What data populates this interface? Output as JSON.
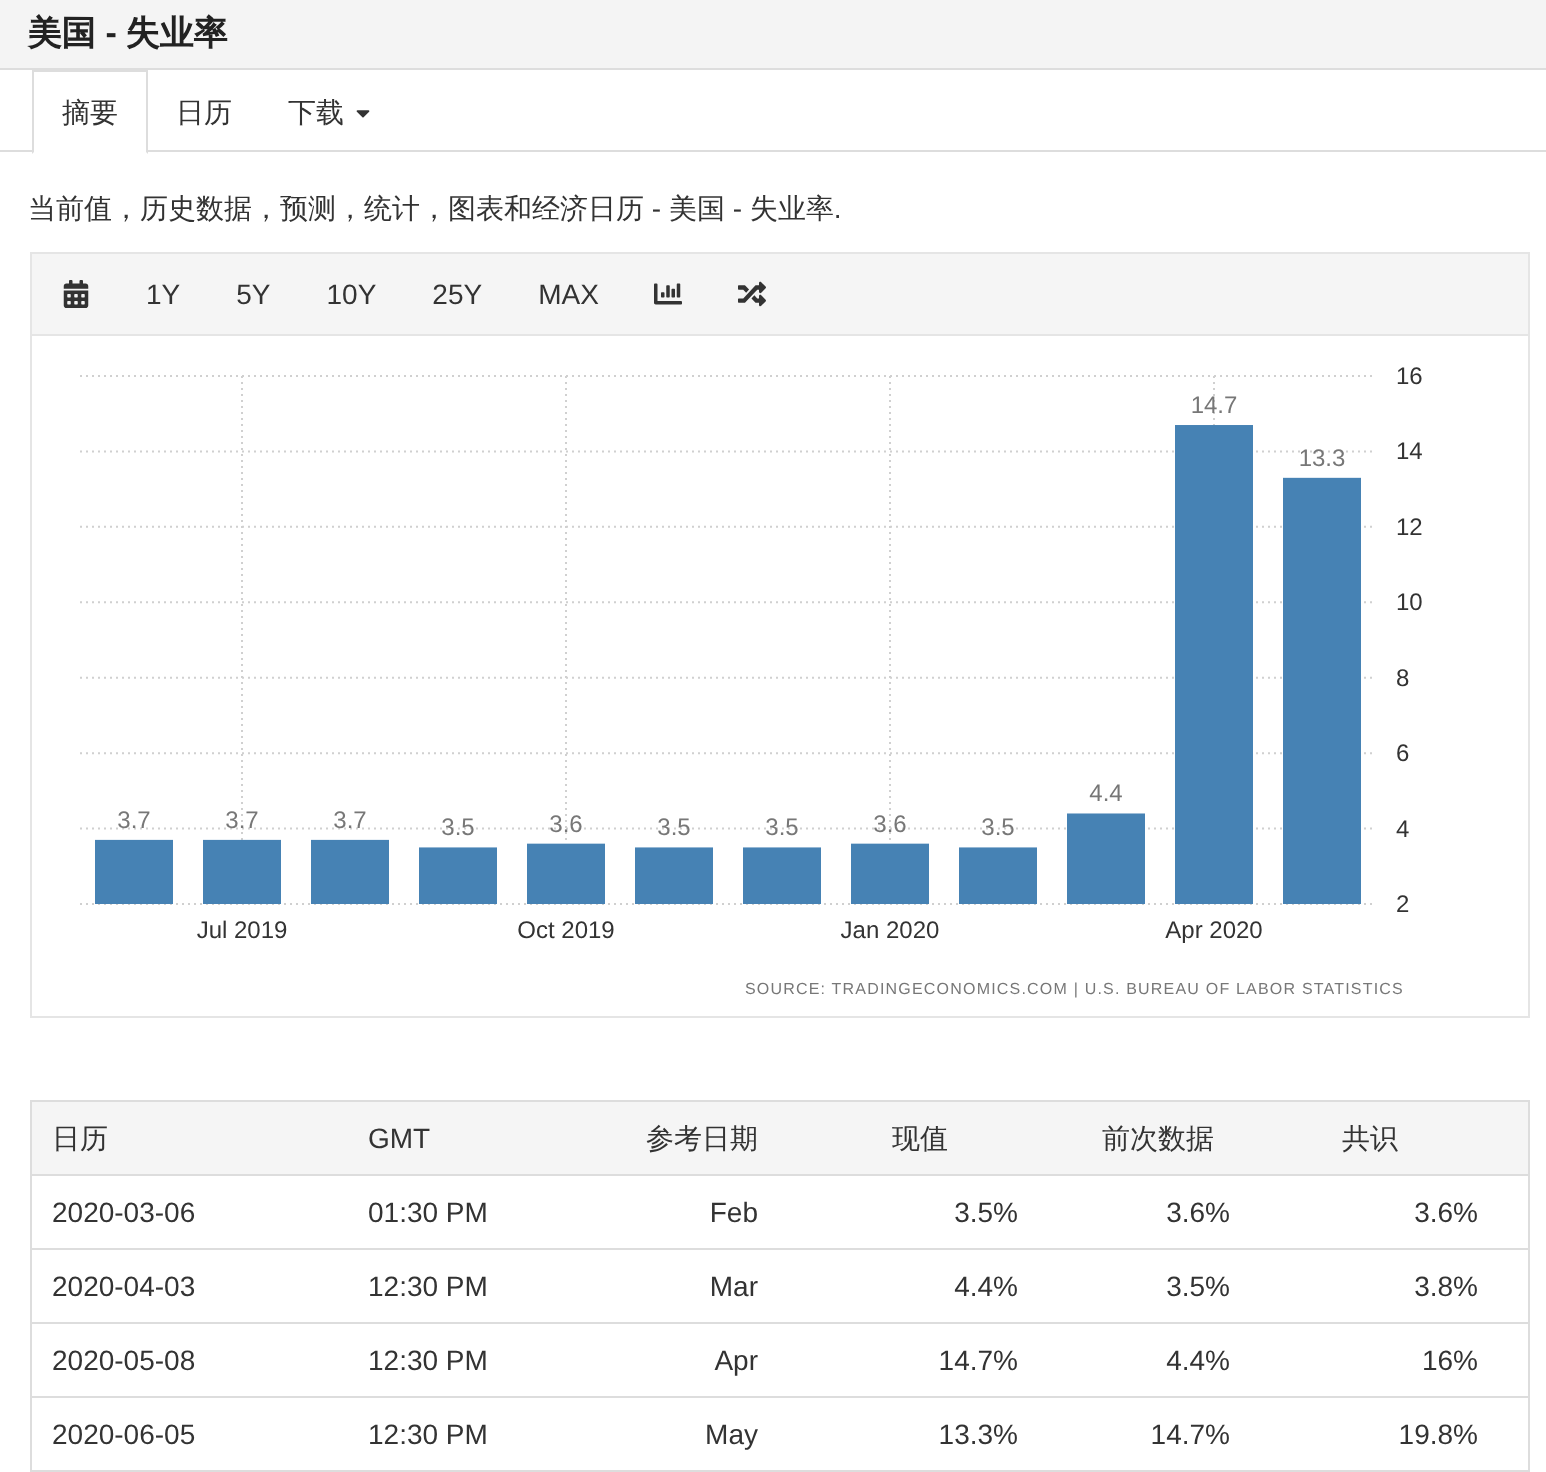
{
  "page_title": "美国 - 失业率",
  "tabs": [
    {
      "label": "摘要",
      "selected": true,
      "dropdown": false
    },
    {
      "label": "日历",
      "selected": false,
      "dropdown": false
    },
    {
      "label": "下载",
      "selected": false,
      "dropdown": true
    }
  ],
  "description": "当前值，历史数据，预测，统计，图表和经济日历 - 美国 - 失业率.",
  "toolbar": [
    {
      "kind": "calendar"
    },
    {
      "kind": "range",
      "label": "1Y"
    },
    {
      "kind": "range",
      "label": "5Y"
    },
    {
      "kind": "range",
      "label": "10Y"
    },
    {
      "kind": "range",
      "label": "25Y"
    },
    {
      "kind": "range",
      "label": "MAX"
    },
    {
      "kind": "bar-chart"
    },
    {
      "kind": "shuffle"
    }
  ],
  "chart_data": {
    "type": "bar",
    "values": [
      3.7,
      3.7,
      3.7,
      3.5,
      3.6,
      3.5,
      3.5,
      3.6,
      3.5,
      4.4,
      14.7,
      13.3
    ],
    "data_labels": true,
    "color": "#4682b4",
    "ylim": [
      2,
      16
    ],
    "yticks": [
      2,
      4,
      6,
      8,
      10,
      12,
      14,
      16
    ],
    "grid": true,
    "categories": [
      null,
      "Jul 2019",
      null,
      null,
      "Oct 2019",
      null,
      null,
      "Jan 2020",
      null,
      null,
      "Apr 2020",
      null
    ]
  },
  "chart_source": "SOURCE: TRADINGECONOMICS.COM | U.S. BUREAU OF LABOR STATISTICS",
  "table": {
    "columns": [
      "日历",
      "GMT",
      "参考日期",
      "现值",
      "前次数据",
      "共识"
    ],
    "rows": [
      [
        "2020-03-06",
        "01:30 PM",
        "Feb",
        "3.5%",
        "3.6%",
        "3.6%"
      ],
      [
        "2020-04-03",
        "12:30 PM",
        "Mar",
        "4.4%",
        "3.5%",
        "3.8%"
      ],
      [
        "2020-05-08",
        "12:30 PM",
        "Apr",
        "14.7%",
        "4.4%",
        "16%"
      ],
      [
        "2020-06-05",
        "12:30 PM",
        "May",
        "13.3%",
        "14.7%",
        "19.8%"
      ]
    ]
  }
}
